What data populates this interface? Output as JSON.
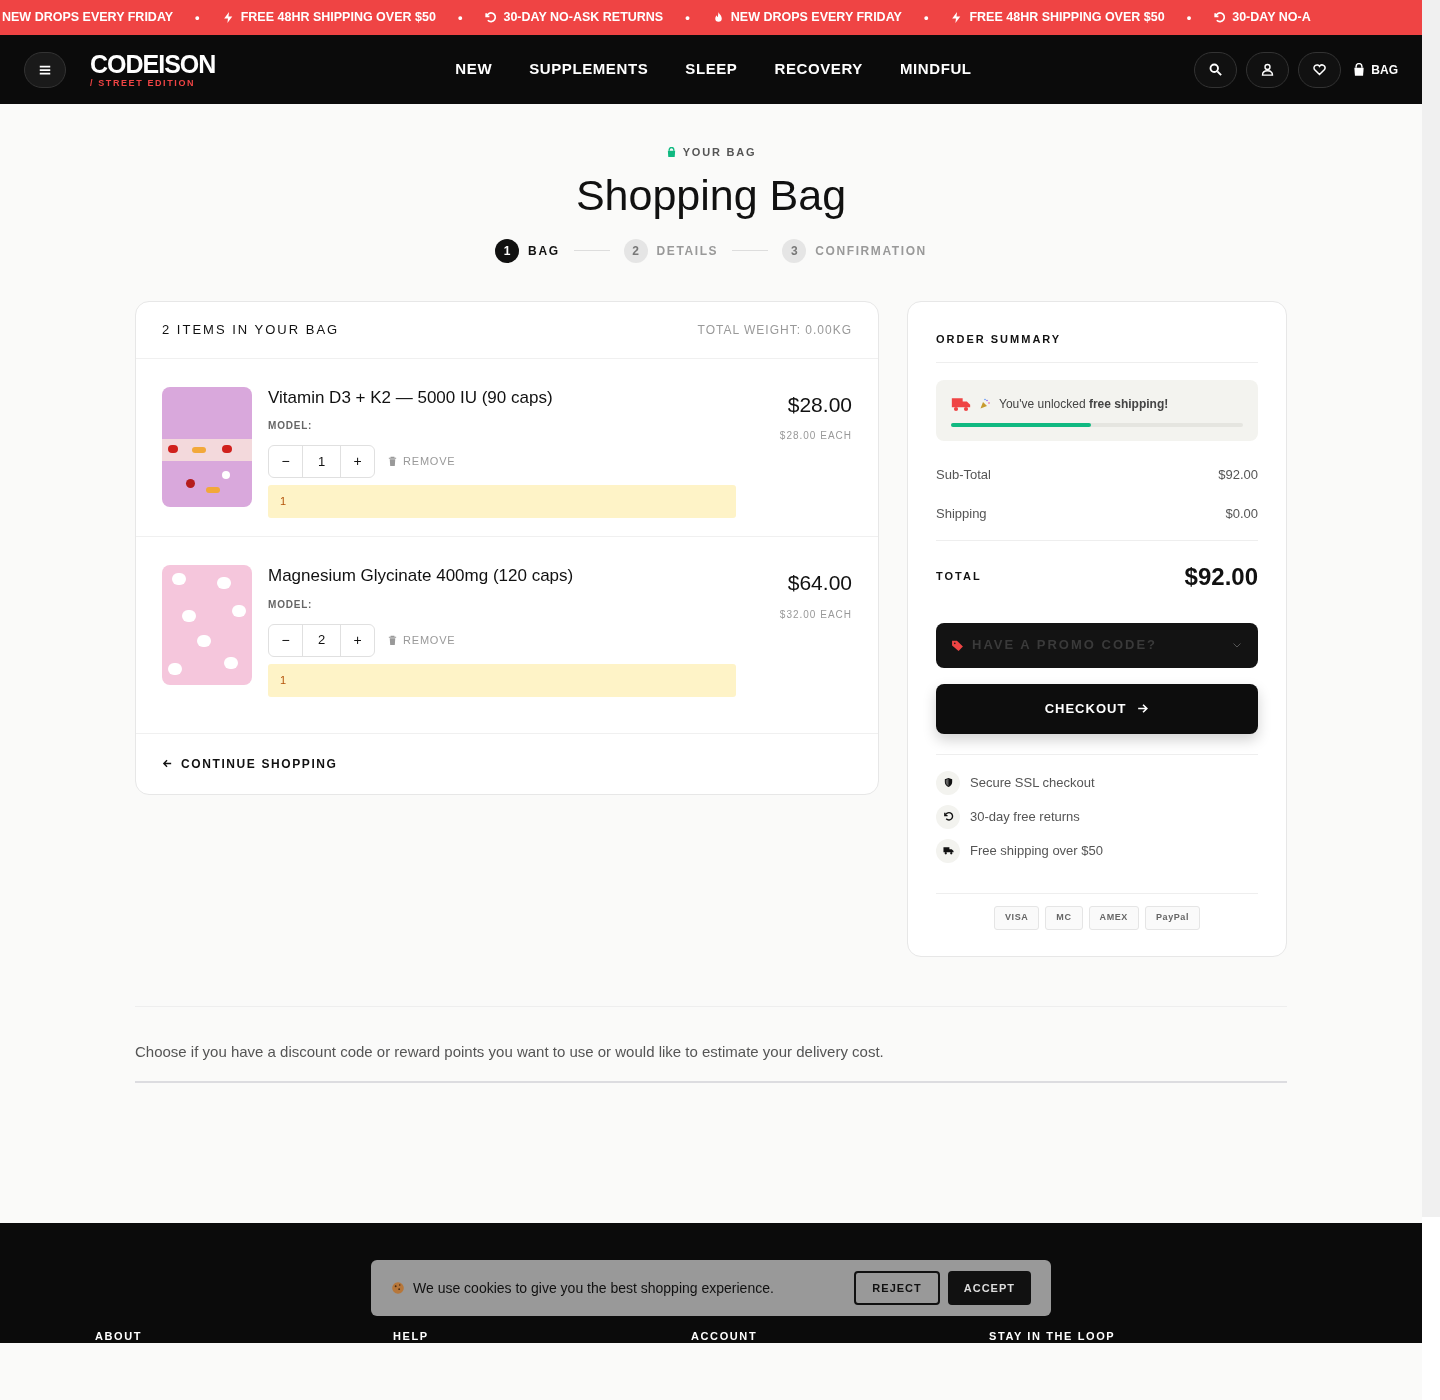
{
  "announcement_bar": [
    {
      "kind": "message",
      "text": "NEW DROPS EVERY FRIDAY"
    },
    {
      "kind": "dot",
      "text": "•"
    },
    {
      "kind": "message",
      "text": "FREE 48HR SHIPPING OVER $50"
    },
    {
      "kind": "dot",
      "text": "•"
    },
    {
      "kind": "message",
      "text": "30-DAY NO-ASK RETURNS"
    },
    {
      "kind": "dot",
      "text": "•"
    },
    {
      "kind": "message",
      "text": "NEW DROPS EVERY FRIDAY"
    },
    {
      "kind": "dot",
      "text": "•"
    },
    {
      "kind": "message",
      "text": "FREE 48HR SHIPPING OVER $50"
    },
    {
      "kind": "dot",
      "text": "•"
    },
    {
      "kind": "message",
      "text": "30-DAY NO-A"
    }
  ],
  "header": {
    "logo": "CODEISON",
    "logo_tagline": "/ STREET EDITION",
    "nav": [
      "NEW",
      "SUPPLEMENTS",
      "SLEEP",
      "RECOVERY",
      "MINDFUL"
    ],
    "bag_label": "BAG"
  },
  "page": {
    "eyebrow": "YOUR BAG",
    "title": "Shopping Bag"
  },
  "steps": [
    {
      "number": "1",
      "label": "BAG",
      "selected": true
    },
    {
      "number": "2",
      "label": "DETAILS",
      "selected": false
    },
    {
      "number": "3",
      "label": "CONFIRMATION",
      "selected": false
    }
  ],
  "cart": {
    "heading": "2 ITEMS IN YOUR BAG",
    "weight": "TOTAL WEIGHT: 0.00KG",
    "items": [
      {
        "name": "Vitamin D3 + K2 — 5000 IU (90 caps)",
        "model_label": "MODEL:",
        "minus": "−",
        "quantity": "1",
        "plus": "+",
        "remove": "REMOVE",
        "note": "1",
        "price": "$28.00",
        "each": "$28.00 EACH"
      },
      {
        "name": "Magnesium Glycinate 400mg (120 caps)",
        "model_label": "MODEL:",
        "minus": "−",
        "quantity": "2",
        "plus": "+",
        "remove": "REMOVE",
        "note": "1",
        "price": "$64.00",
        "each": "$32.00 EACH"
      }
    ],
    "continue": "CONTINUE SHOPPING"
  },
  "summary": {
    "heading": "ORDER SUMMARY",
    "shipping_banner": "You've unlocked **free shipping!**",
    "shipping_progress": {
      "level": 0.48
    },
    "lines": [
      {
        "label": "Sub-Total",
        "value": "$92.00"
      },
      {
        "label": "Shipping",
        "value": "$0.00"
      }
    ],
    "total_label": "TOTAL",
    "total": "$92.00",
    "promo": "HAVE A PROMO CODE?",
    "checkout": "CHECKOUT",
    "assurances": [
      {
        "text": "Secure SSL checkout"
      },
      {
        "text": "30-day free returns"
      },
      {
        "text": "Free shipping over $50"
      }
    ],
    "payment_methods": [
      "VISA",
      "MC",
      "AMEX",
      "PayPal"
    ]
  },
  "info_text": "Choose if you have a discount code or reward points you want to use or would like to estimate your delivery cost.",
  "footer": {
    "columns": [
      "ABOUT",
      "HELP",
      "ACCOUNT",
      "STAY IN THE LOOP"
    ]
  },
  "cookie_banner": {
    "text": "We use cookies to give you the best shopping experience.",
    "reject": "REJECT",
    "accept": "ACCEPT"
  }
}
